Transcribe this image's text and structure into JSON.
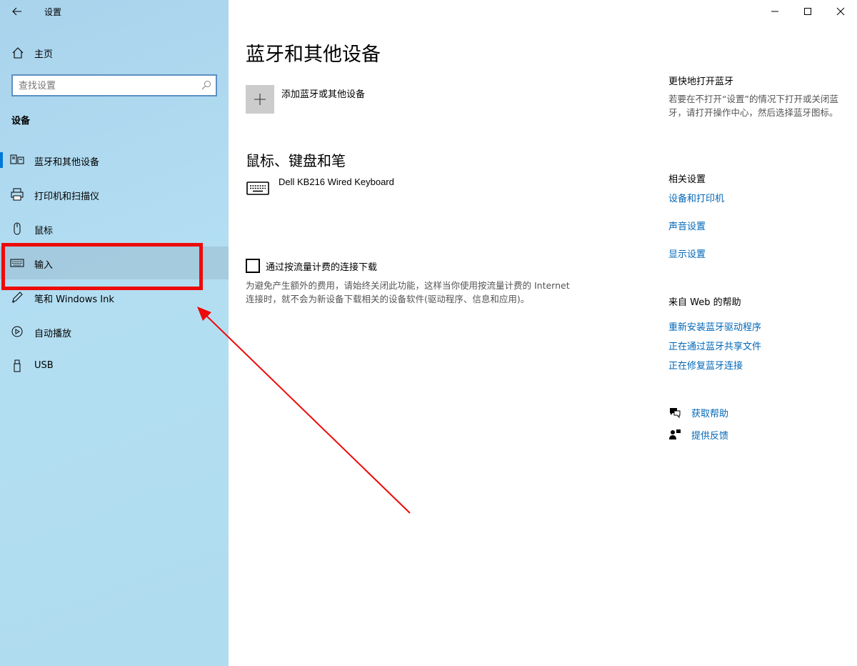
{
  "window": {
    "app_title": "设置",
    "controls": [
      "minimize-icon",
      "maximize-icon",
      "close-icon"
    ]
  },
  "sidebar": {
    "home_label": "主页",
    "search_placeholder": "查找设置",
    "section_title": "设备",
    "items": [
      {
        "label": "蓝牙和其他设备",
        "icon": "bluetooth-devices-icon",
        "selected": true
      },
      {
        "label": "打印机和扫描仪",
        "icon": "printer-icon"
      },
      {
        "label": "鼠标",
        "icon": "mouse-icon"
      },
      {
        "label": "输入",
        "icon": "keyboard-icon",
        "highlighted": true
      },
      {
        "label": "笔和 Windows Ink",
        "icon": "pen-icon"
      },
      {
        "label": "自动播放",
        "icon": "autoplay-icon"
      },
      {
        "label": "USB",
        "icon": "usb-icon"
      }
    ]
  },
  "main": {
    "title": "蓝牙和其他设备",
    "add_device_label": "添加蓝牙或其他设备",
    "section_title": "鼠标、键盘和笔",
    "device_name": "Dell KB216 Wired Keyboard",
    "metered_checkbox_label": "通过按流量计费的连接下载",
    "metered_checked": false,
    "metered_description": "为避免产生额外的费用，请始终关闭此功能，这样当你使用按流量计费的 Internet 连接时，就不会为新设备下载相关的设备软件(驱动程序、信息和应用)。"
  },
  "right_panel": {
    "quick_title": "更快地打开蓝牙",
    "quick_text": "若要在不打开“设置”的情况下打开或关闭蓝牙，请打开操作中心，然后选择蓝牙图标。",
    "related_title": "相关设置",
    "related_links": [
      "设备和打印机",
      "声音设置",
      "显示设置"
    ],
    "web_help_title": "来自 Web 的帮助",
    "web_links": [
      "重新安装蓝牙驱动程序",
      "正在通过蓝牙共享文件",
      "正在修复蓝牙连接"
    ],
    "get_help": "获取帮助",
    "feedback": "提供反馈"
  },
  "colors": {
    "accent": "#0078d7",
    "link": "#0067b8",
    "annotation_red": "#ee0a0a",
    "sidebar_bg": "#b0dcf0"
  }
}
